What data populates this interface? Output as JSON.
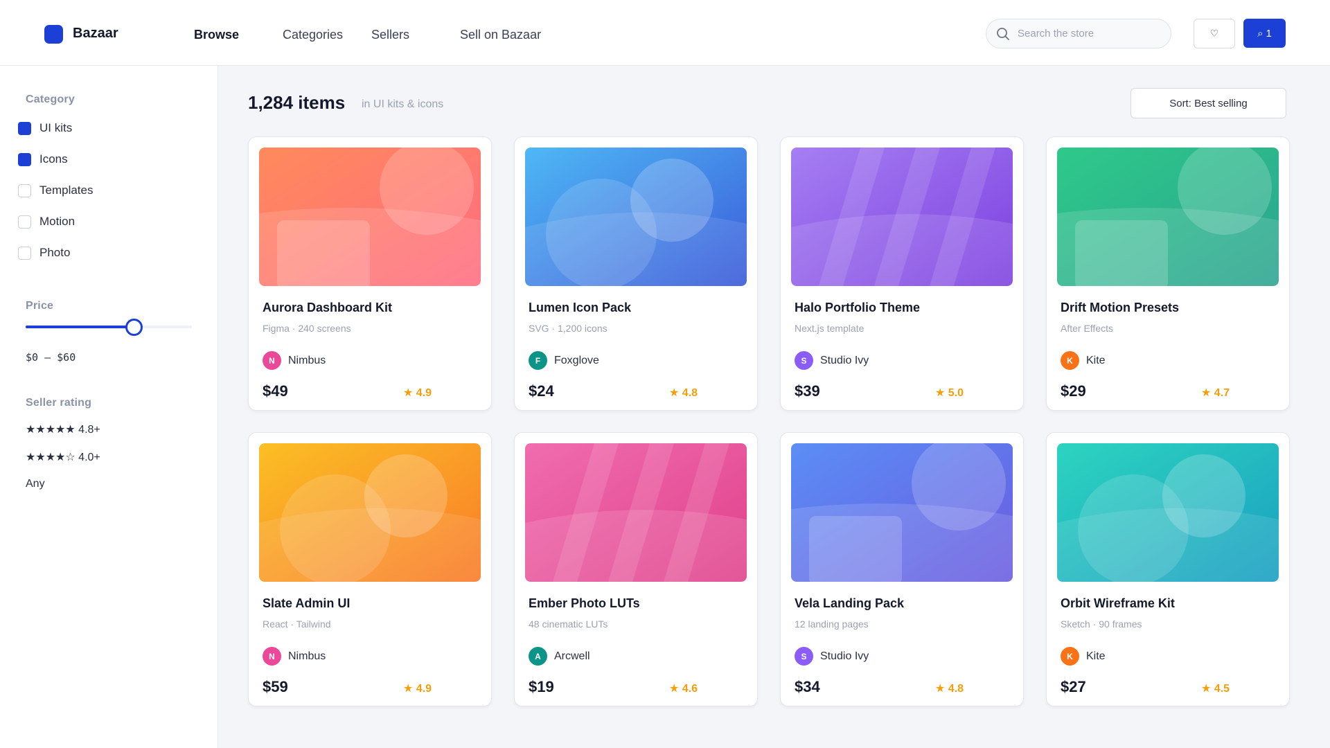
{
  "header": {
    "brand": "Bazaar",
    "nav": [
      "Browse",
      "Categories",
      "Sellers",
      "Sell on Bazaar"
    ],
    "search_placeholder": "Search the store",
    "wishlist_icon": "heart-icon",
    "cart_icon": "bag-icon",
    "cart_count": "1",
    "accent": "#1c3fd6"
  },
  "sidebar": {
    "category_title": "Category",
    "categories": [
      {
        "label": "UI kits",
        "checked": true
      },
      {
        "label": "Icons",
        "checked": true
      },
      {
        "label": "Templates",
        "checked": false
      },
      {
        "label": "Motion",
        "checked": false
      },
      {
        "label": "Photo",
        "checked": false
      }
    ],
    "price_title": "Price",
    "price_slider_fraction": 0.65,
    "price_range": "$0 – $60",
    "rating_title": "Seller rating",
    "rating_options": [
      "★★★★★ 4.8+",
      "★★★★☆ 4.0+",
      "Any"
    ]
  },
  "main": {
    "count": "1,284 items",
    "count_sub": "in UI kits & icons",
    "sort_label": "Sort: Best selling"
  },
  "products": [
    {
      "title": "Aurora Dashboard Kit",
      "sub": "Figma · 240 screens",
      "seller": "Nimbus",
      "initial": "N",
      "avatar": "#ec4899",
      "price": "$49",
      "rating": "★ 4.9",
      "g1": "#ff8a5b",
      "g2": "#ff6b81",
      "pattern": "rect"
    },
    {
      "title": "Lumen Icon Pack",
      "sub": "SVG · 1,200 icons",
      "seller": "Foxglove",
      "initial": "F",
      "avatar": "#0d9488",
      "price": "$24",
      "rating": "★ 4.8",
      "g1": "#4fb8f5",
      "g2": "#3a5ad9",
      "pattern": "circles"
    },
    {
      "title": "Halo Portfolio Theme",
      "sub": "Next.js template",
      "seller": "Studio Ivy",
      "initial": "S",
      "avatar": "#8b5cf6",
      "price": "$39",
      "rating": "★ 5.0",
      "g1": "#a67ff2",
      "g2": "#7c3fe0",
      "pattern": "stripes"
    },
    {
      "title": "Drift Motion Presets",
      "sub": "After Effects",
      "seller": "Kite",
      "initial": "K",
      "avatar": "#f97316",
      "price": "$29",
      "rating": "★ 4.7",
      "g1": "#2ec98a",
      "g2": "#2aa38f",
      "pattern": "rect"
    },
    {
      "title": "Slate Admin UI",
      "sub": "React · Tailwind",
      "seller": "Nimbus",
      "initial": "N",
      "avatar": "#ec4899",
      "price": "$59",
      "rating": "★ 4.9",
      "g1": "#fbbf24",
      "g2": "#f97b2a",
      "pattern": "circles"
    },
    {
      "title": "Ember Photo LUTs",
      "sub": "48 cinematic LUTs",
      "seller": "Arcwell",
      "initial": "A",
      "avatar": "#0d9488",
      "price": "$19",
      "rating": "★ 4.6",
      "g1": "#f06daf",
      "g2": "#e0408a",
      "pattern": "stripes"
    },
    {
      "title": "Vela Landing Pack",
      "sub": "12 landing pages",
      "seller": "Studio Ivy",
      "initial": "S",
      "avatar": "#8b5cf6",
      "price": "$34",
      "rating": "★ 4.8",
      "g1": "#5b8ef5",
      "g2": "#6a5ae0",
      "pattern": "rect"
    },
    {
      "title": "Orbit Wireframe Kit",
      "sub": "Sketch · 90 frames",
      "seller": "Kite",
      "initial": "K",
      "avatar": "#f97316",
      "price": "$27",
      "rating": "★ 4.5",
      "g1": "#2dd4bf",
      "g2": "#1a9fc2",
      "pattern": "circles"
    }
  ]
}
